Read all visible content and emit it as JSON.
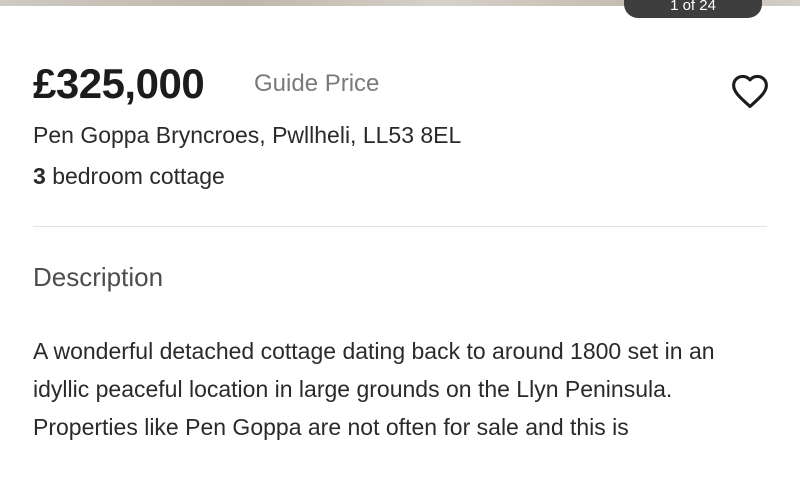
{
  "gallery": {
    "counter": "1 of 24"
  },
  "listing": {
    "price": "£325,000",
    "price_qualifier": "Guide Price",
    "address": "Pen Goppa Bryncroes, Pwllheli, LL53 8EL",
    "bedrooms": "3",
    "property_type": "bedroom cottage"
  },
  "icons": {
    "favourite": "heart-outline-icon"
  },
  "description": {
    "heading": "Description",
    "paragraphs": [
      "A wonderful detached cottage dating back to around 1800 set in an idyllic peaceful location in large grounds on the Llyn Peninsula.",
      "Properties like Pen Goppa are not often for sale and this is"
    ]
  }
}
